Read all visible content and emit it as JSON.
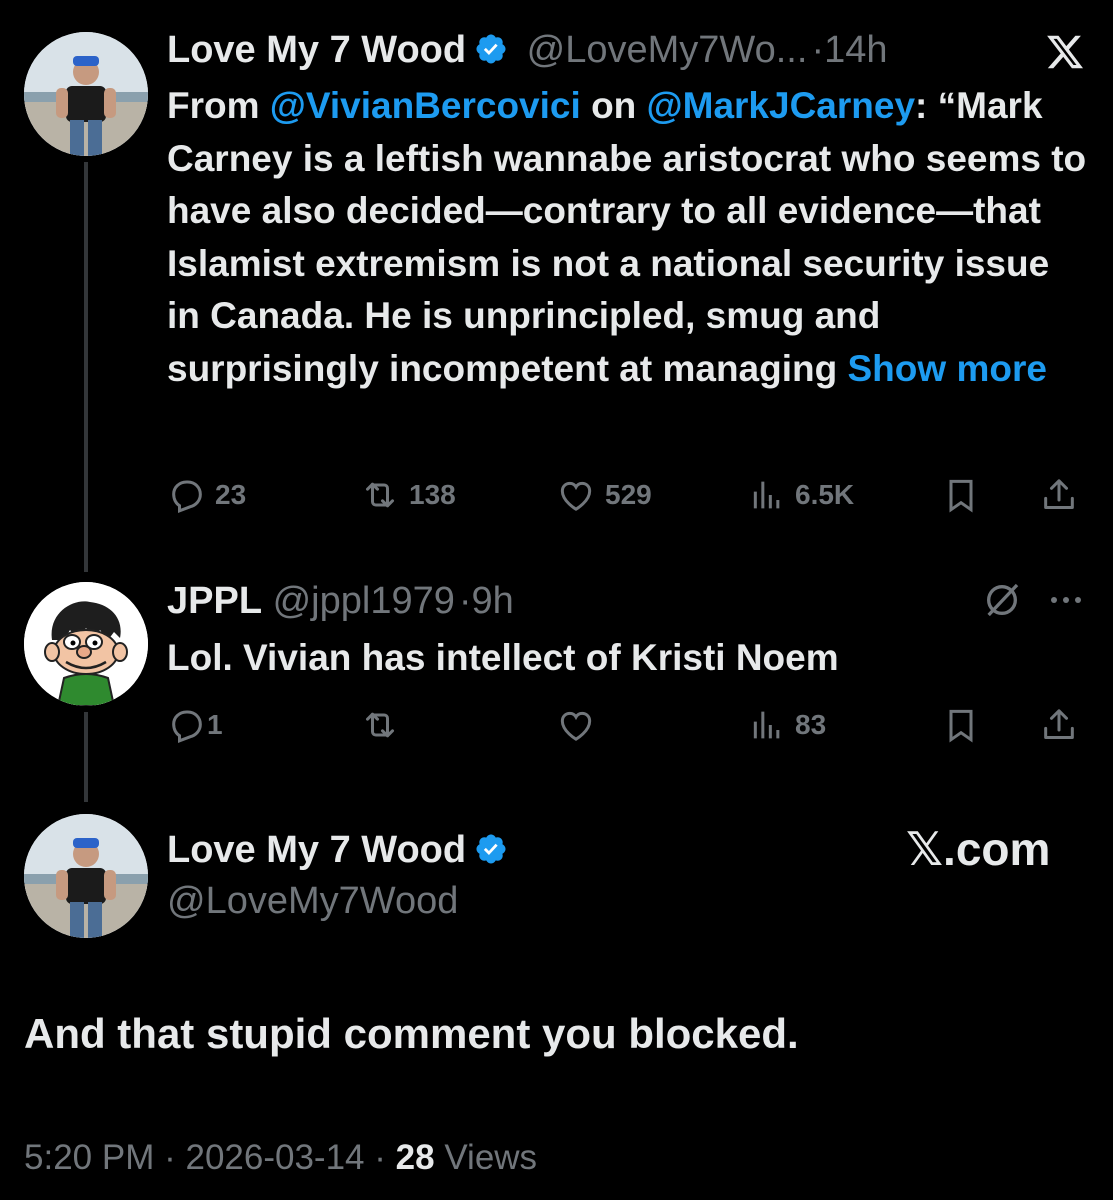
{
  "colors": {
    "background": "#000000",
    "text": "#e7e9ea",
    "muted": "#71767b",
    "link": "#1d9bf0",
    "verified": "#1d9bf0"
  },
  "post1": {
    "name": "Love My 7 Wood",
    "handle": "@LoveMy7Wo...",
    "separator": "·",
    "time": "14h",
    "text_from": "From",
    "mention1": "@VivianBercovici",
    "text_on": "on",
    "mention2": "@MarkJCarney",
    "text_colon": ":",
    "body": "“Mark Carney is a leftish wannabe aristocrat who seems to have also decided—contrary to all evidence—that Islamist extremism is not a national security issue in Canada. He is unprincipled, smug and surprisingly incompetent at managing",
    "show_more": "Show more",
    "replies": "23",
    "reposts": "138",
    "likes": "529",
    "views": "6.5K",
    "icons": [
      "x-logo-icon",
      "reply-icon",
      "repost-icon",
      "like-icon",
      "views-icon",
      "bookmark-icon",
      "share-icon"
    ]
  },
  "post2": {
    "name": "JPPL",
    "handle": "@jppl1979",
    "separator": "·",
    "time": "9h",
    "text": "Lol. Vivian has intellect of Kristi Noem",
    "replies": "1",
    "reposts": "",
    "likes": "",
    "views": "83",
    "icons": [
      "grok-icon",
      "more-icon",
      "reply-icon",
      "repost-icon",
      "like-icon",
      "views-icon",
      "bookmark-icon",
      "share-icon"
    ]
  },
  "post3": {
    "name": "Love My 7 Wood",
    "handle": "@LoveMy7Wood",
    "site": "𝕏.com",
    "text": "And that stupid comment you blocked.",
    "time": "5:20 PM",
    "separator": "·",
    "date": "2026-03-14",
    "views_count": "28",
    "views_label": "Views"
  }
}
